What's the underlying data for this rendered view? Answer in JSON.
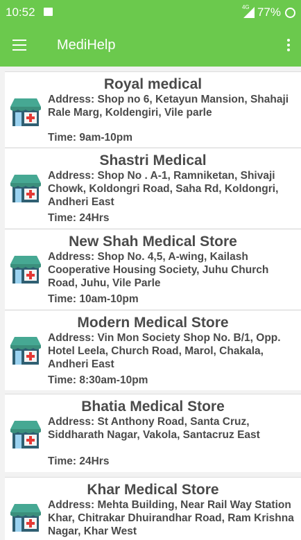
{
  "status_bar": {
    "time": "10:52",
    "network": "4G",
    "battery": "77%"
  },
  "app_bar": {
    "title": "MediHelp"
  },
  "stores": [
    {
      "name": "Royal medical",
      "address": "Address: Shop no 6, Ketayun Mansion, Shahaji Rale Marg, Koldengiri, Vile parle",
      "time": "Time: 9am-10pm"
    },
    {
      "name": "Shastri Medical",
      "address": "Address: Shop No . A-1, Ramniketan, Shivaji Chowk, Koldongri Road, Saha Rd, Koldongri, Andheri East",
      "time": "Time: 24Hrs"
    },
    {
      "name": "New Shah Medical Store",
      "address": "Address: Shop No. 4,5, A-wing, Kailash Cooperative Housing Society, Juhu Church Road, Juhu, Vile Parle",
      "time": "Time: 10am-10pm"
    },
    {
      "name": "Modern Medical Store",
      "address": "Address: Vin Mon Society Shop No. B/1, Opp. Hotel Leela, Church Road, Marol, Chakala, Andheri East",
      "time": "Time: 8:30am-10pm"
    },
    {
      "name": "Bhatia Medical Store",
      "address": "Address: St Anthony Road, Santa Cruz, Siddharath Nagar, Vakola, Santacruz East",
      "time": "Time: 24Hrs"
    },
    {
      "name": "Khar Medical Store",
      "address": "Address: Mehta Building, Near Rail Way Station Khar, Chitrakar Dhuirandhar Road, Ram Krishna Nagar, Khar West",
      "time": ""
    }
  ],
  "colors": {
    "primary": "#6bc94d",
    "text": "#4a4a4a",
    "awning": "#46a893",
    "shop_body": "#2f5f72",
    "cross": "#e53935"
  },
  "icons": {
    "menu": "menu-icon",
    "overflow": "more-vert-icon",
    "store": "medical-store-icon"
  }
}
